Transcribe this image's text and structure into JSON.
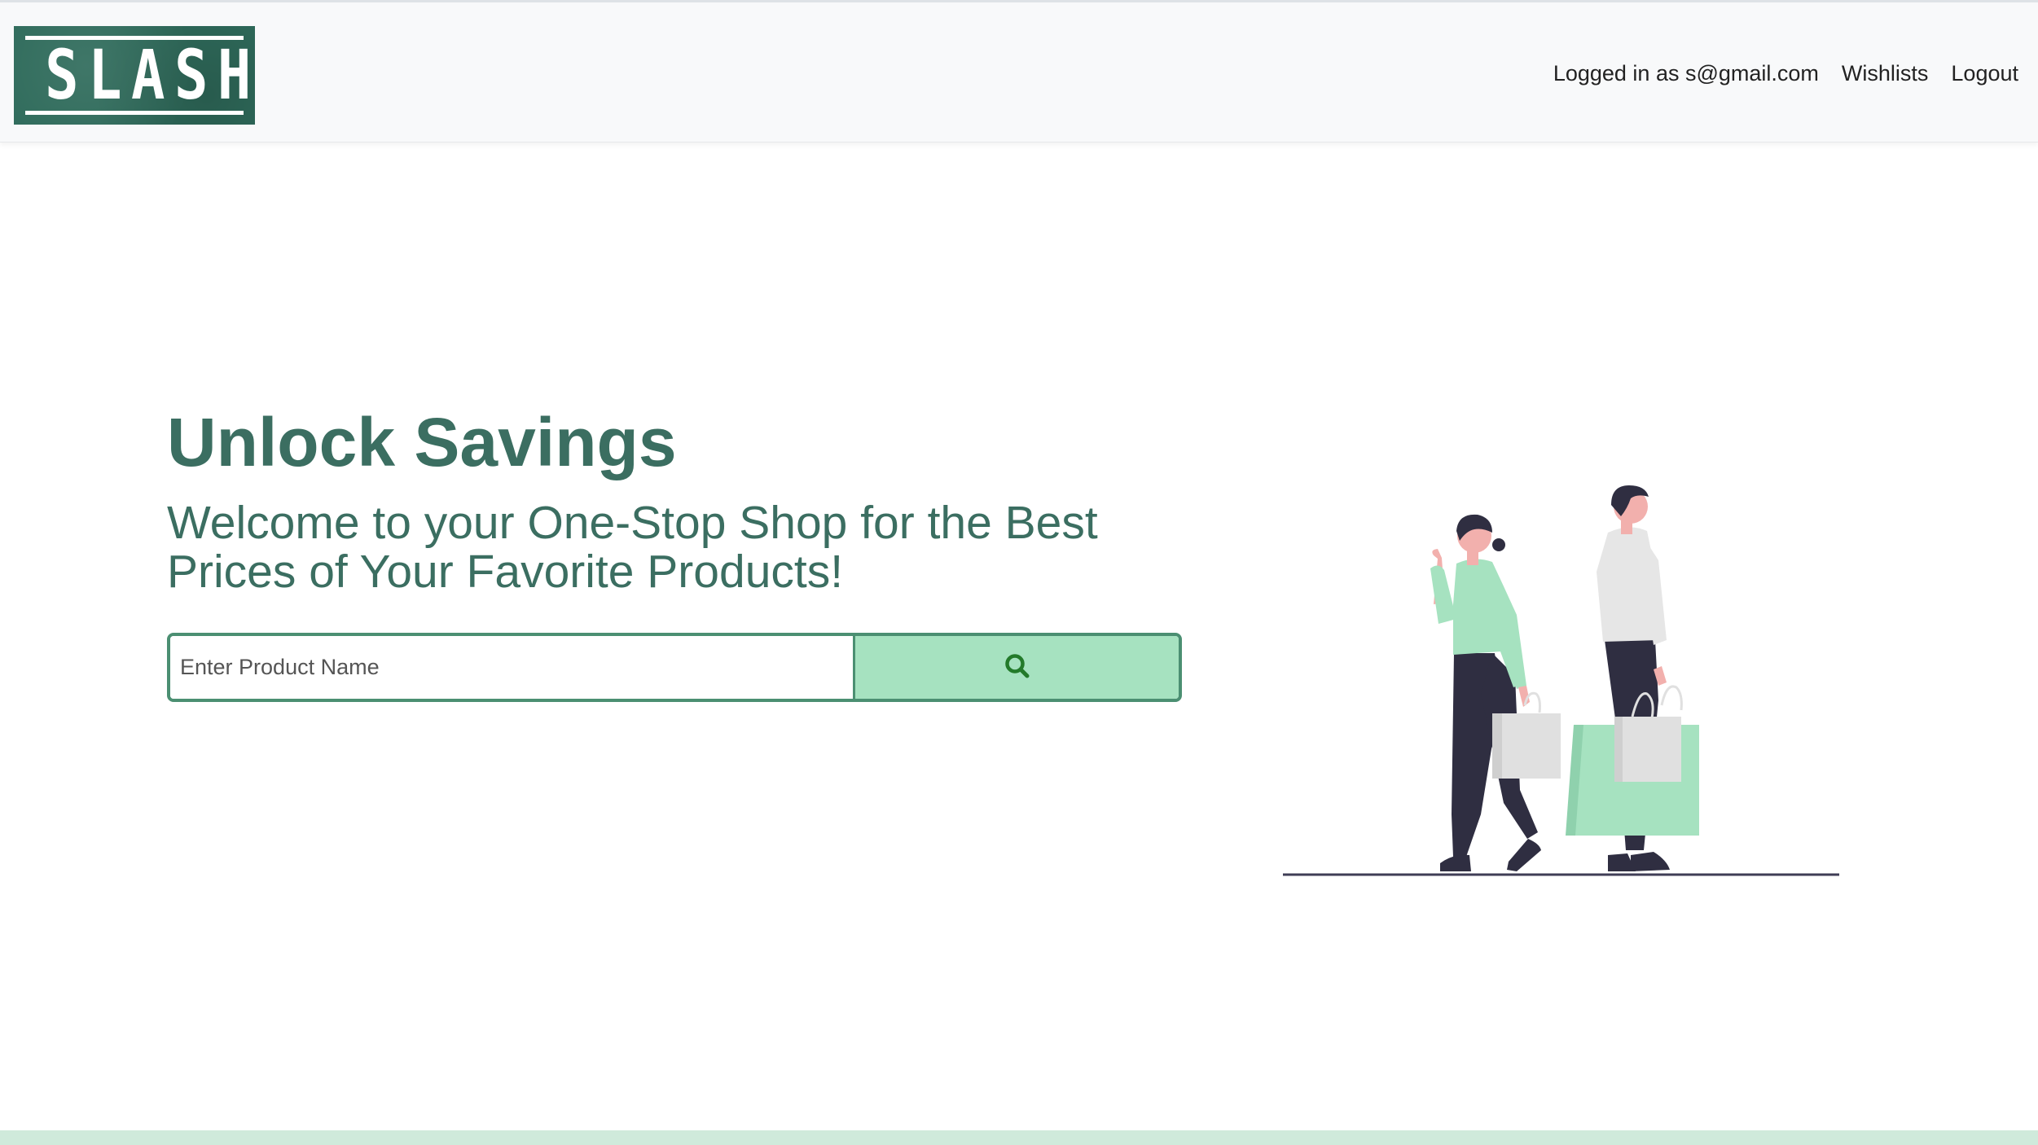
{
  "header": {
    "logo_text": "SLASH",
    "nav": {
      "logged_in_text": "Logged in as s@gmail.com",
      "wishlists_label": "Wishlists",
      "logout_label": "Logout"
    }
  },
  "hero": {
    "title": "Unlock Savings",
    "subtitle": "Welcome to your One-Stop Shop for the Best Prices of Your Favorite Products!"
  },
  "search": {
    "placeholder": "Enter Product Name",
    "value": "",
    "button_icon": "search-icon"
  },
  "illustration": {
    "description_icon": "shoppers-illustration"
  },
  "colors": {
    "brand_green": "#3b6e61",
    "accent_mint": "#a6e2c0",
    "border_green": "#4b8f72",
    "navbar_bg": "#f8f9fa",
    "footer_mint": "#cfeadb"
  }
}
